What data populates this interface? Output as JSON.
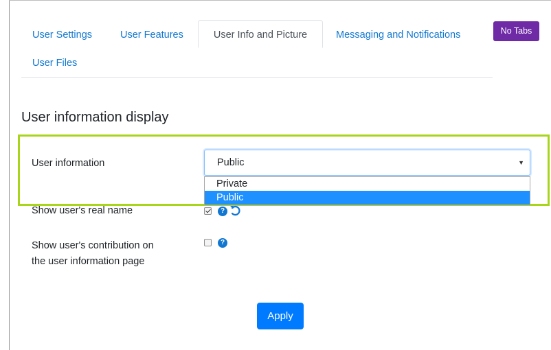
{
  "tabs": {
    "items": [
      {
        "label": "User Settings"
      },
      {
        "label": "User Features"
      },
      {
        "label": "User Info and Picture"
      },
      {
        "label": "Messaging and Notifications"
      },
      {
        "label": "User Files"
      }
    ],
    "active_index": 2,
    "no_tabs_label": "No Tabs"
  },
  "section": {
    "title": "User information display"
  },
  "fields": {
    "user_information": {
      "label": "User information",
      "value": "Public",
      "options": [
        "Private",
        "Public"
      ],
      "highlighted_option": "Public"
    },
    "real_name": {
      "label": "Show user's real name",
      "checked": true,
      "help_icon": "question-circle-icon",
      "reset_icon": "undo-icon"
    },
    "contribution": {
      "label_line1": "Show user's contribution on",
      "label_line2": "the user information page",
      "checked": false,
      "help_icon": "question-circle-icon"
    }
  },
  "help_glyph": "?",
  "apply_label": "Apply",
  "colors": {
    "link": "#1177d1",
    "no_tabs_button": "#6f2aa6",
    "apply_button": "#007bff",
    "highlight_border": "#a8d51a",
    "selected_option": "#1e90ff"
  }
}
